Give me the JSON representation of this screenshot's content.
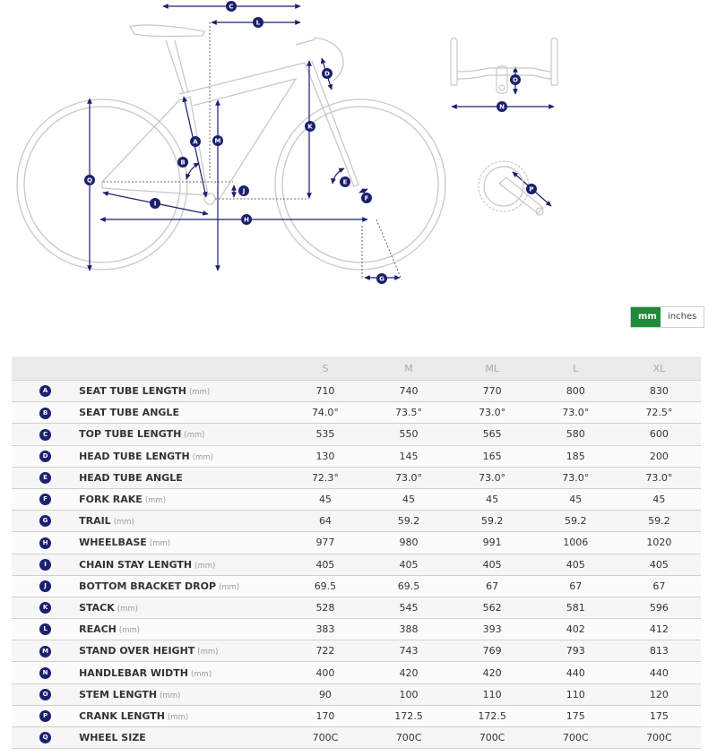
{
  "diagram": {
    "labels": [
      "A",
      "B",
      "C",
      "D",
      "E",
      "F",
      "G",
      "H",
      "I",
      "J",
      "K",
      "L",
      "M",
      "N",
      "O",
      "P",
      "Q"
    ]
  },
  "unit_toggle": {
    "active": "mm",
    "inactive": "inches"
  },
  "colors": {
    "accent": "#1a1f6e",
    "toggle_active": "#1f8a3a",
    "line": "#c8c8c8"
  },
  "table": {
    "sizes": [
      "S",
      "M",
      "ML",
      "L",
      "XL"
    ],
    "rows": [
      {
        "letter": "A",
        "label": "SEAT TUBE LENGTH",
        "unit": "(mm)",
        "values": [
          "710",
          "740",
          "770",
          "800",
          "830"
        ]
      },
      {
        "letter": "B",
        "label": "SEAT TUBE ANGLE",
        "unit": "",
        "values": [
          "74.0°",
          "73.5°",
          "73.0°",
          "73.0°",
          "72.5°"
        ]
      },
      {
        "letter": "C",
        "label": "TOP TUBE LENGTH",
        "unit": "(mm)",
        "values": [
          "535",
          "550",
          "565",
          "580",
          "600"
        ]
      },
      {
        "letter": "D",
        "label": "HEAD TUBE LENGTH",
        "unit": "(mm)",
        "values": [
          "130",
          "145",
          "165",
          "185",
          "200"
        ]
      },
      {
        "letter": "E",
        "label": "HEAD TUBE ANGLE",
        "unit": "",
        "values": [
          "72.3°",
          "73.0°",
          "73.0°",
          "73.0°",
          "73.0°"
        ]
      },
      {
        "letter": "F",
        "label": "FORK RAKE",
        "unit": "(mm)",
        "values": [
          "45",
          "45",
          "45",
          "45",
          "45"
        ]
      },
      {
        "letter": "G",
        "label": "TRAIL",
        "unit": "(mm)",
        "values": [
          "64",
          "59.2",
          "59.2",
          "59.2",
          "59.2"
        ]
      },
      {
        "letter": "H",
        "label": "WHEELBASE",
        "unit": "(mm)",
        "values": [
          "977",
          "980",
          "991",
          "1006",
          "1020"
        ]
      },
      {
        "letter": "I",
        "label": "CHAIN STAY LENGTH",
        "unit": "(mm)",
        "values": [
          "405",
          "405",
          "405",
          "405",
          "405"
        ]
      },
      {
        "letter": "J",
        "label": "BOTTOM BRACKET DROP",
        "unit": "(mm)",
        "values": [
          "69.5",
          "69.5",
          "67",
          "67",
          "67"
        ]
      },
      {
        "letter": "K",
        "label": "STACK",
        "unit": "(mm)",
        "values": [
          "528",
          "545",
          "562",
          "581",
          "596"
        ]
      },
      {
        "letter": "L",
        "label": "REACH",
        "unit": "(mm)",
        "values": [
          "383",
          "388",
          "393",
          "402",
          "412"
        ]
      },
      {
        "letter": "M",
        "label": "STAND OVER HEIGHT",
        "unit": "(mm)",
        "values": [
          "722",
          "743",
          "769",
          "793",
          "813"
        ]
      },
      {
        "letter": "N",
        "label": "HANDLEBAR WIDTH",
        "unit": "(mm)",
        "values": [
          "400",
          "420",
          "420",
          "440",
          "440"
        ]
      },
      {
        "letter": "O",
        "label": "STEM LENGTH",
        "unit": "(mm)",
        "values": [
          "90",
          "100",
          "110",
          "110",
          "120"
        ]
      },
      {
        "letter": "P",
        "label": "CRANK LENGTH",
        "unit": "(mm)",
        "values": [
          "170",
          "172.5",
          "172.5",
          "175",
          "175"
        ]
      },
      {
        "letter": "Q",
        "label": "WHEEL SIZE",
        "unit": "",
        "values": [
          "700C",
          "700C",
          "700C",
          "700C",
          "700C"
        ]
      }
    ]
  }
}
